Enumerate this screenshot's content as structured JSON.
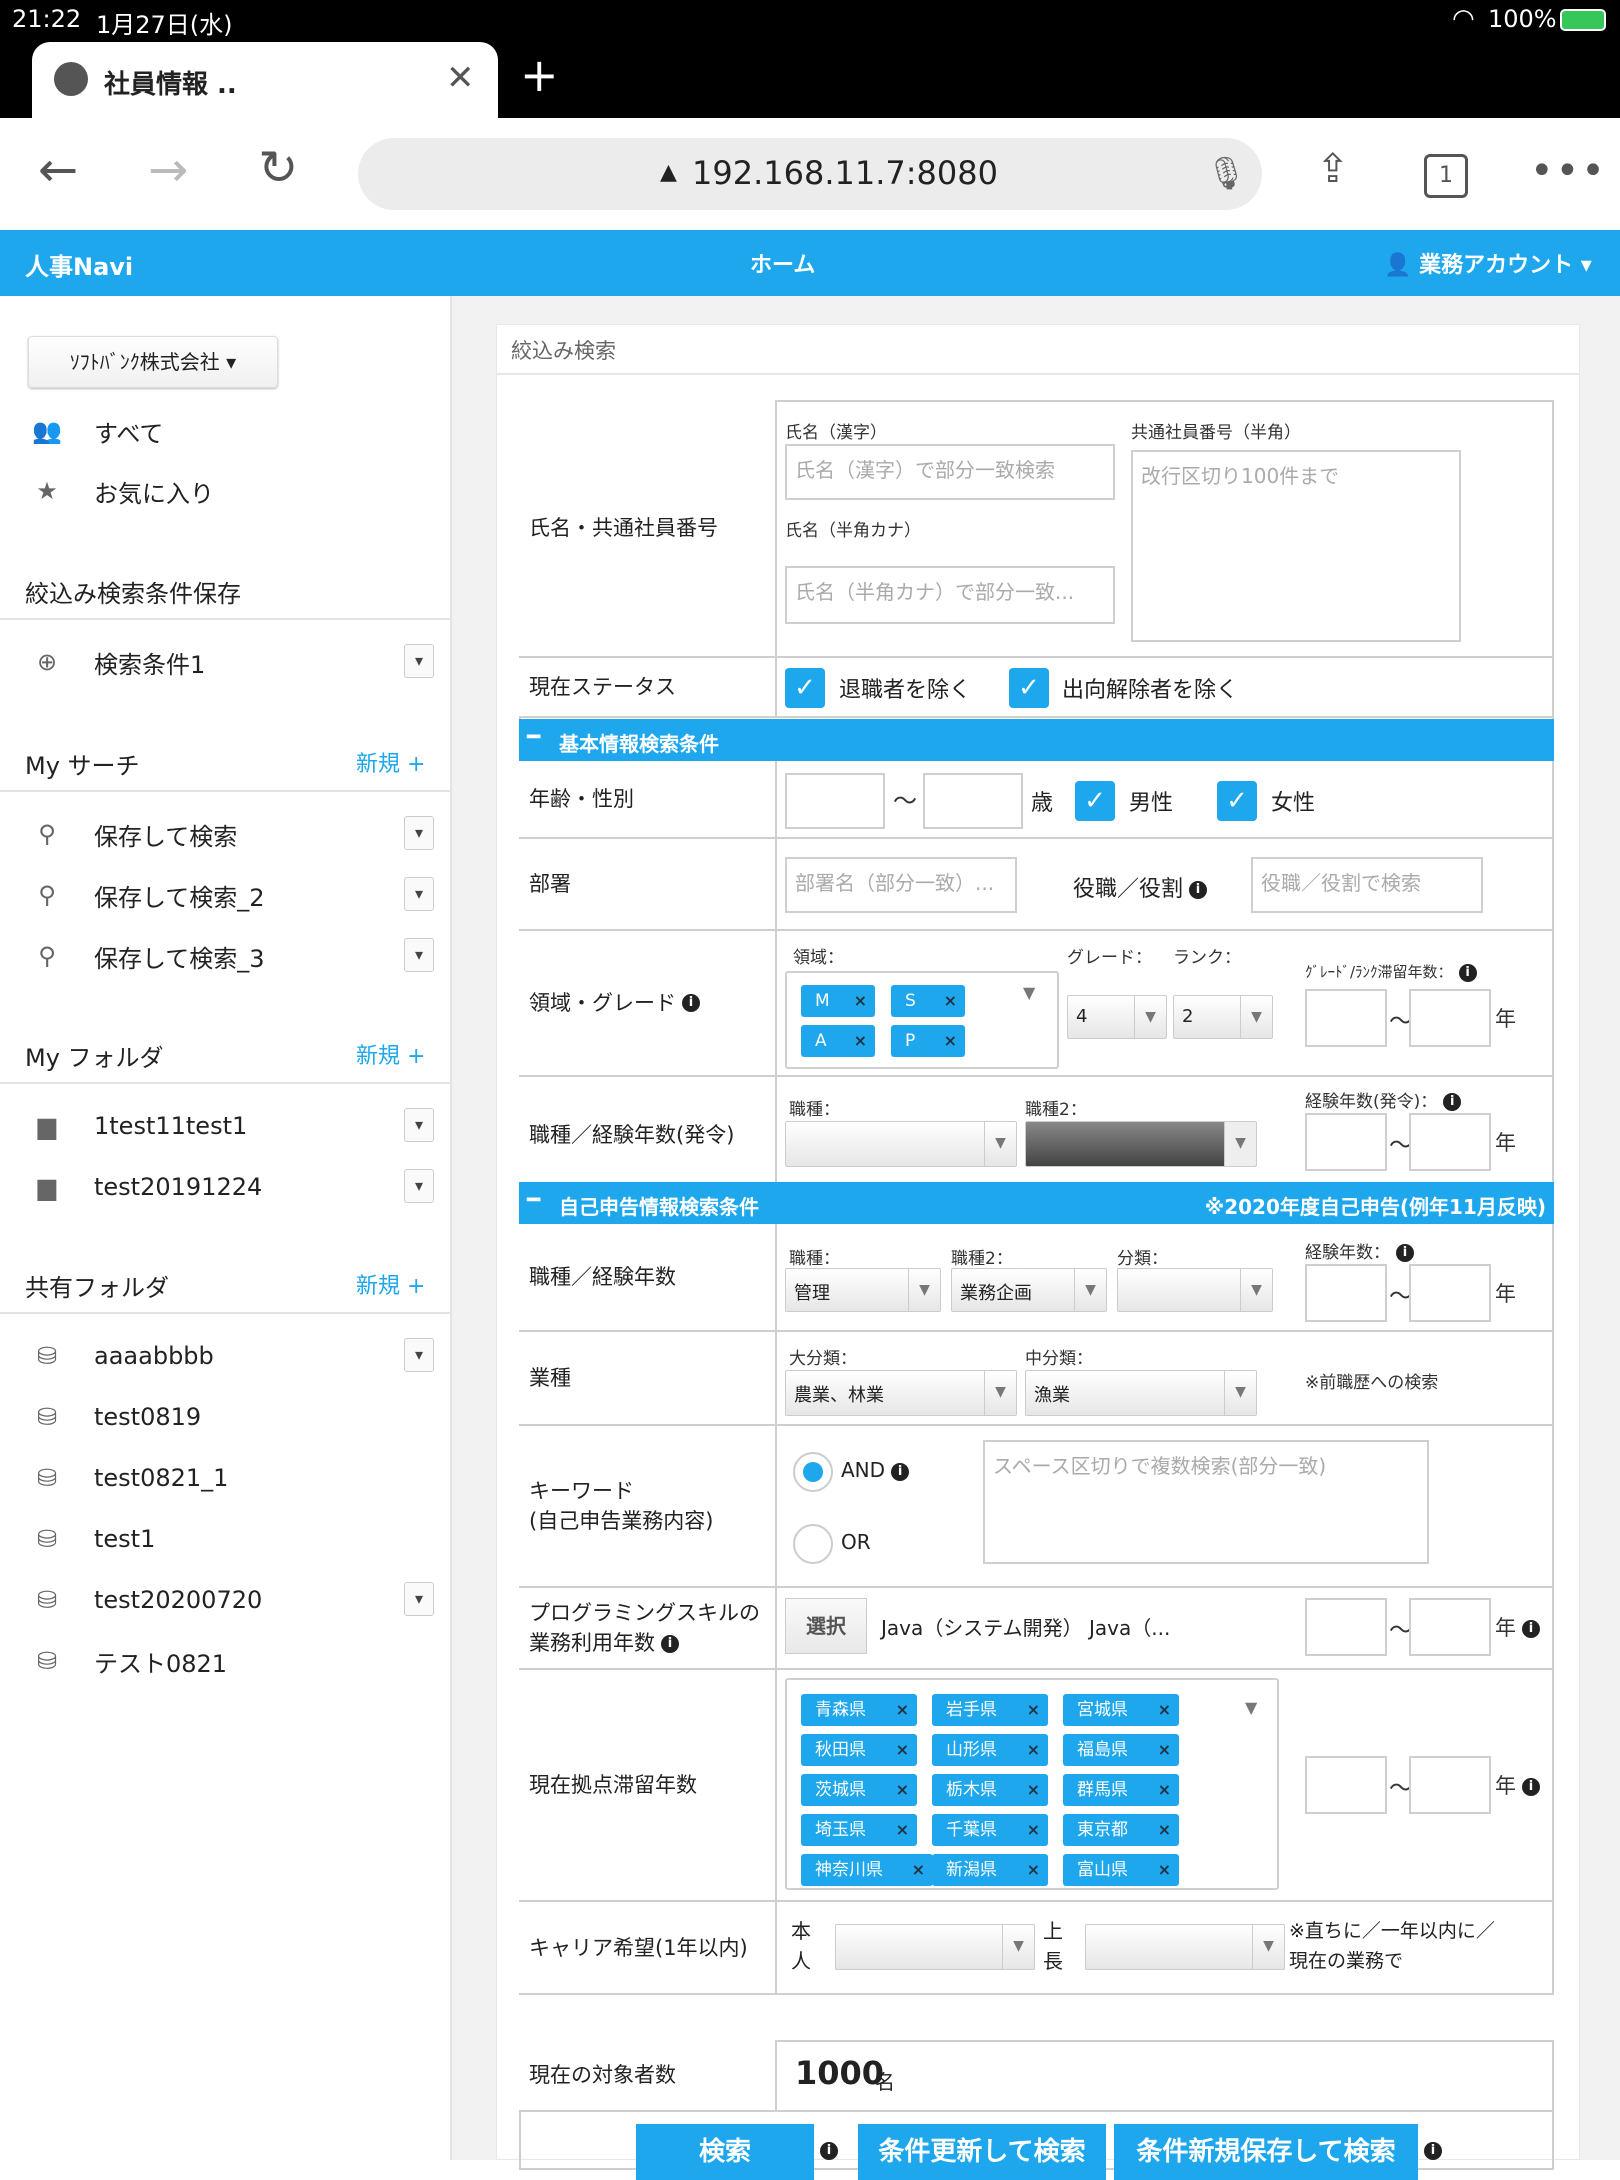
{
  "status": {
    "time": "21:22",
    "date": "1月27日(水)",
    "battery": "100%"
  },
  "browser": {
    "tab_title": "社員情報 ..",
    "url": "192.168.11.7:8080",
    "tab_count": "1"
  },
  "app": {
    "brand": "人事Navi",
    "home": "ホーム",
    "account": "業務アカウント"
  },
  "sidebar": {
    "company": "ｿﾌﾄﾊﾞﾝｸ株式会社",
    "all": "すべて",
    "favorites": "お気に入り",
    "saved_header": "絞込み検索条件保存",
    "saved_items": [
      "検索条件1"
    ],
    "my_search_header": "My サーチ",
    "my_search_items": [
      "保存して検索",
      "保存して検索_2",
      "保存して検索_3"
    ],
    "my_folder_header": "My フォルダ",
    "my_folder_items": [
      "1test11test1",
      "test20191224"
    ],
    "shared_header": "共有フォルダ",
    "shared_items": [
      "aaaabbbb",
      "test0819",
      "test0821_1",
      "test1",
      "test20200720",
      "テスト0821"
    ],
    "new_label": "新規"
  },
  "panel": {
    "title": "絞込み検索"
  },
  "form": {
    "name_row": {
      "label": "氏名・共通社員番号",
      "kanji_label": "氏名（漢字）",
      "kanji_ph": "氏名（漢字）で部分一致検索",
      "kana_label": "氏名（半角カナ）",
      "kana_ph": "氏名（半角カナ）で部分一致...",
      "empno_label": "共通社員番号（半角）",
      "empno_ph": "改行区切り100件まで"
    },
    "status_row": {
      "label": "現在ステータス",
      "opt1": "退職者を除く",
      "opt2": "出向解除者を除く"
    },
    "section1": "基本情報検索条件",
    "age_row": {
      "label": "年齢・性別",
      "sai": "歳",
      "male": "男性",
      "female": "女性",
      "tilde": "〜"
    },
    "dept_row": {
      "label": "部署",
      "dept_ph": "部署名（部分一致）...",
      "role_label": "役職／役割",
      "role_ph": "役職／役割で検索"
    },
    "grade_row": {
      "label": "領域・グレード",
      "domain_label": "領域：",
      "domains": [
        "M",
        "S",
        "A",
        "P"
      ],
      "grade_label": "グレード：",
      "grade_value": "4",
      "rank_label": "ランク：",
      "rank_value": "2",
      "stay_label": "ｸﾞﾚｰﾄﾞ/ﾗﾝｸ滞留年数：",
      "nen": "年"
    },
    "job_row": {
      "label": "職種／経験年数(発令)",
      "job_label": "職種：",
      "job2_label": "職種2：",
      "exp_label": "経験年数(発令)："
    },
    "section2": "自己申告情報検索条件",
    "section2_note": "※2020年度自己申告(例年11月反映)",
    "sjob_row": {
      "label": "職種／経験年数",
      "job_label": "職種：",
      "job_value": "管理",
      "job2_label": "職種2：",
      "job2_value": "業務企画",
      "cat_label": "分類：",
      "exp_label": "経験年数："
    },
    "industry_row": {
      "label": "業種",
      "major_label": "大分類：",
      "major_value": "農業、林業",
      "minor_label": "中分類：",
      "minor_value": "漁業",
      "note": "※前職歴への検索"
    },
    "keyword_row": {
      "label1": "キーワード",
      "label2": "(自己申告業務内容)",
      "and": "AND",
      "or": "OR",
      "ph": "スペース区切りで複数検索(部分一致)"
    },
    "skill_row": {
      "label1": "プログラミングスキルの",
      "label2": "業務利用年数",
      "select_btn": "選択",
      "value": "Java（システム開発） Java（..."
    },
    "base_row": {
      "label": "現在拠点滞留年数",
      "prefs": [
        "青森県",
        "岩手県",
        "宮城県",
        "秋田県",
        "山形県",
        "福島県",
        "茨城県",
        "栃木県",
        "群馬県",
        "埼玉県",
        "千葉県",
        "東京都",
        "神奈川県",
        "新潟県",
        "富山県"
      ]
    },
    "career_row": {
      "label": "キャリア希望(1年以内)",
      "self": "本人",
      "boss": "上長",
      "note1": "※直ちに／一年以内に／",
      "note2": "現在の業務で"
    }
  },
  "summary": {
    "label": "現在の対象者数",
    "count": "1000",
    "unit": "名"
  },
  "actions": {
    "search": "検索",
    "update": "条件更新して検索",
    "save_new": "条件新規保存して検索"
  }
}
